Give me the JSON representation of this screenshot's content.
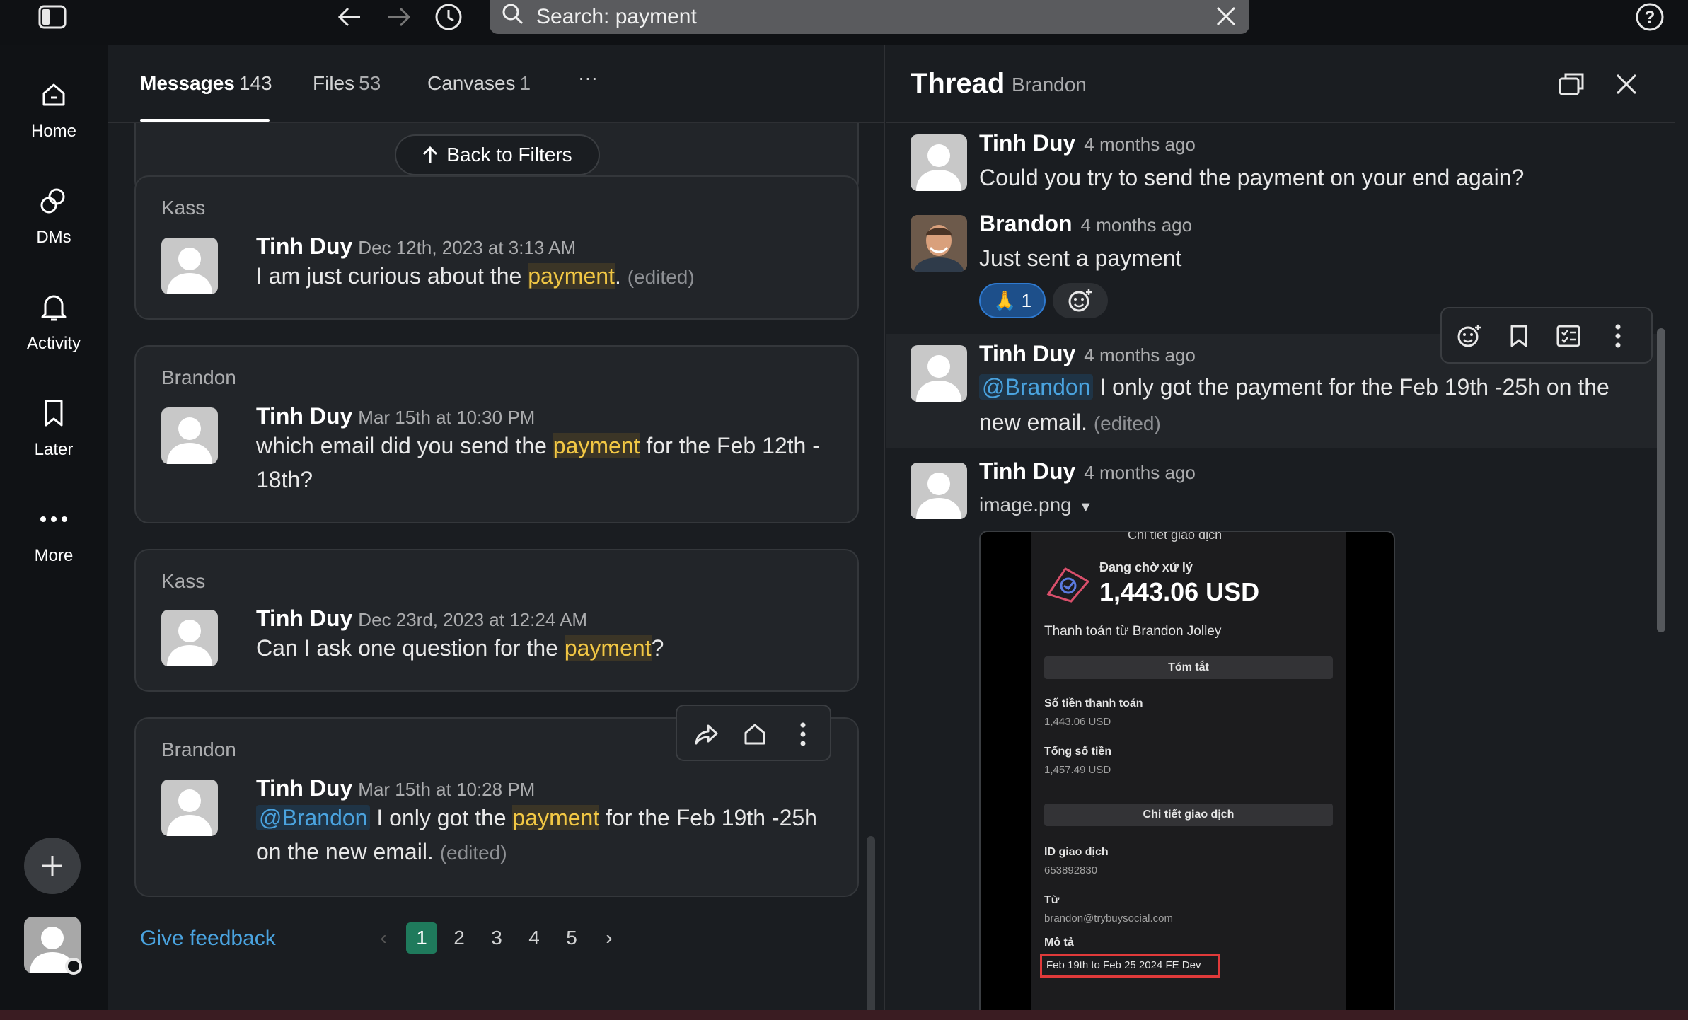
{
  "search": {
    "text": "Search: payment"
  },
  "rail": {
    "home": "Home",
    "dms": "DMs",
    "activity": "Activity",
    "later": "Later",
    "more": "More"
  },
  "tabs": [
    {
      "label": "Messages",
      "count": "143"
    },
    {
      "label": "Files",
      "count": "53"
    },
    {
      "label": "Canvases",
      "count": "1"
    }
  ],
  "tabs_more": "···",
  "back_to_filters": "Back to Filters",
  "results": [
    {
      "channel": "Kass",
      "author": "Tinh Duy",
      "time": "Dec 12th, 2023 at 3:13 AM",
      "pre": "I am just curious about the ",
      "hl": "payment",
      "post": ".",
      "edited": "(edited)"
    },
    {
      "channel": "Brandon",
      "author": "Tinh Duy",
      "time": "Mar 15th at 10:30 PM",
      "pre": "which email did you send the ",
      "hl": "payment",
      "post": " for the Feb 12th - 18th?"
    },
    {
      "channel": "Kass",
      "author": "Tinh Duy",
      "time": "Dec 23rd, 2023 at 12:24 AM",
      "pre": "Can I ask one question for the ",
      "hl": "payment",
      "post": "?"
    },
    {
      "channel": "Brandon",
      "author": "Tinh Duy",
      "time": "Mar 15th at 10:28 PM",
      "mention": "@Brandon",
      "pre": " I only got the ",
      "hl": "payment",
      "post": " for the Feb 19th -25h on the new email.",
      "edited": "(edited)"
    }
  ],
  "give_feedback": "Give feedback",
  "pagination": {
    "prev": "‹",
    "pages": [
      "1",
      "2",
      "3",
      "4",
      "5"
    ],
    "next": "›",
    "current": "1"
  },
  "thread": {
    "title": "Thread",
    "subtitle": "Brandon",
    "messages": [
      {
        "author": "Tinh Duy",
        "time": "4 months ago",
        "text": "Could you try to send the payment on your end again?"
      },
      {
        "author": "Brandon",
        "time": "4 months ago",
        "text": "Just sent a payment"
      },
      {
        "author": "Tinh Duy",
        "time": "4 months ago",
        "mention": "@Brandon",
        "text": " I only got the payment for the Feb 19th -25h on the new email.",
        "edited": "(edited)"
      },
      {
        "author": "Tinh Duy",
        "time": "4 months ago",
        "file": "image.png"
      }
    ],
    "reaction": {
      "emoji": "🙏",
      "count": "1"
    }
  },
  "receipt": {
    "header": "Chi tiết giao dịch",
    "status": "Đang chờ xử lý",
    "amount": "1,443.06 USD",
    "from_line": "Thanh toán từ Brandon Jolley",
    "summary_btn": "Tóm tắt",
    "amount_label": "Số tiền thanh toán",
    "amount_value": "1,443.06 USD",
    "total_label": "Tổng số tiền",
    "total_value": "1,457.49 USD",
    "details_btn": "Chi tiết giao dịch",
    "id_label": "ID giao dịch",
    "id_value": "653892830",
    "from_label": "Từ",
    "from_value": "brandon@trybuysocial.com",
    "desc_label": "Mô tả",
    "desc_value": "Feb 19th to Feb 25 2024 FE Dev"
  },
  "colors": {
    "highlight": "#f2c744",
    "link": "#4aa3df",
    "page_active": "#1f7a5c",
    "reaction": "#1d4f8a",
    "redbox": "#e03a3a"
  }
}
